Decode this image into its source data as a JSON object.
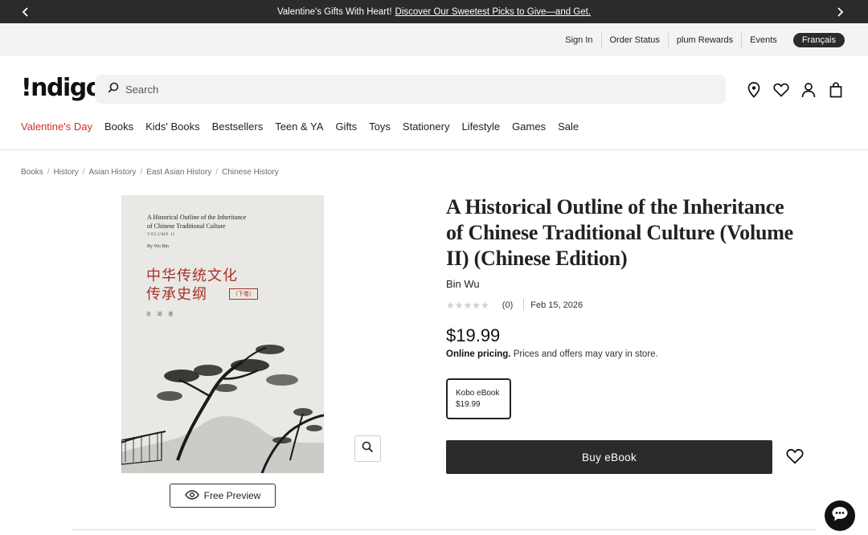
{
  "promo": {
    "prefix": "Valentine's Gifts With Heart!",
    "link": "Discover Our Sweetest Picks to Give—and Get."
  },
  "utility_links": [
    "Sign In",
    "Order Status",
    "plum Rewards",
    "Events"
  ],
  "language_button": "Français",
  "logo": "!ndigo",
  "search": {
    "placeholder": "Search"
  },
  "header_icons": [
    "location-icon",
    "heart-icon",
    "account-icon",
    "bag-icon"
  ],
  "nav": [
    "Valentine's Day",
    "Books",
    "Kids' Books",
    "Bestsellers",
    "Teen & YA",
    "Gifts",
    "Toys",
    "Stationery",
    "Lifestyle",
    "Games",
    "Sale"
  ],
  "breadcrumb": [
    "Books",
    "History",
    "Asian History",
    "East Asian History",
    "Chinese History"
  ],
  "cover": {
    "title_line1": "A Historical Outline of the Inheritance",
    "title_line2": "of Chinese Traditional Culture",
    "volume": "VOLUME II",
    "by": "By Wu Bin",
    "cn_line1": "中华传统文化",
    "cn_line2": "传承史纲",
    "cn_volume": "（下卷）",
    "cn_author": "吴 斌 著"
  },
  "preview_button": "Free Preview",
  "product": {
    "title": "A Historical Outline of the Inheritance of Chinese Traditional Culture (Volume II) (Chinese Edition)",
    "author": "Bin Wu",
    "stars": "★★★★★",
    "rating": 0,
    "rating_count": "(0)",
    "date": "Feb 15, 2026",
    "price": "$19.99",
    "pricing_bold": "Online pricing.",
    "pricing_note": "Prices and offers may vary in store.",
    "format_name": "Kobo eBook",
    "format_price": "$19.99",
    "buy_button": "Buy eBook"
  },
  "colors": {
    "accent_red": "#d62b2b",
    "dark": "#2b2b2b",
    "cover_red": "#a8312a"
  }
}
